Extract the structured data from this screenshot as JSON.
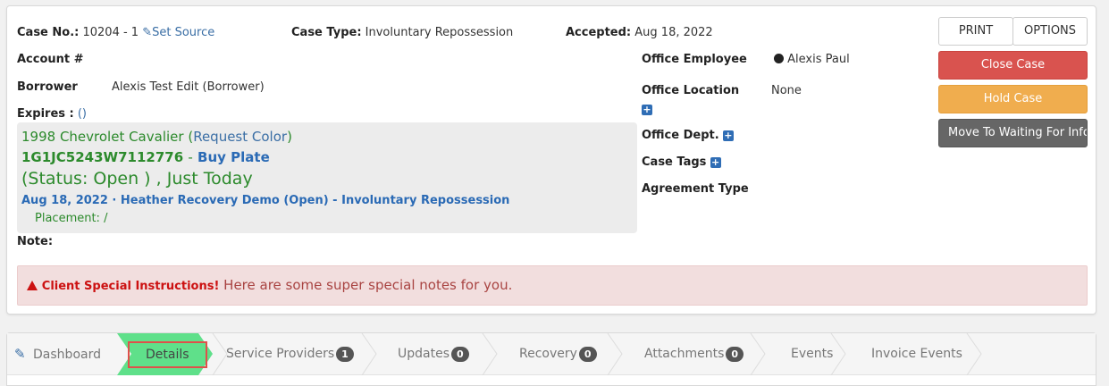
{
  "case": {
    "case_no_label": "Case No.:",
    "case_no_value": "10204 - 1",
    "set_source": "Set Source",
    "case_type_label": "Case Type:",
    "case_type_value": "Involuntary Repossession",
    "accepted_label": "Accepted:",
    "accepted_value": "Aug 18, 2022",
    "account_label": "Account #",
    "borrower_label": "Borrower",
    "borrower_value": "Alexis Test Edit (Borrower)",
    "expires_label": "Expires :",
    "expires_value": "()",
    "note_label": "Note:"
  },
  "vehicle": {
    "name": "1998 Chevrolet Cavalier",
    "request_color_open": "(",
    "request_color": "Request Color",
    "request_color_close": ")",
    "vin": "1G1JC5243W7112776",
    "dash": "-",
    "buy_plate": "Buy Plate",
    "status": "(Status: Open ) , Just Today",
    "assignment": "Aug 18, 2022 · Heather Recovery Demo (Open) - Involuntary Repossession",
    "placement": "Placement: /"
  },
  "office": {
    "employee_label": "Office Employee",
    "employee_value": "Alexis Paul",
    "location_label": "Office Location",
    "location_value": "None",
    "dept_label": "Office Dept.",
    "tags_label": "Case Tags",
    "agreement_label": "Agreement Type"
  },
  "actions": {
    "print": "PRINT",
    "options": "OPTIONS",
    "close_case": "Close Case",
    "hold_case": "Hold Case",
    "move_waiting": "Move To Waiting For Info"
  },
  "alert": {
    "title": "Client Special Instructions!",
    "message": "Here are some super special notes for you."
  },
  "tabs": [
    {
      "label": "Dashboard"
    },
    {
      "label": "Details",
      "active": true
    },
    {
      "label": "Service Providers",
      "badge": "1"
    },
    {
      "label": "Updates",
      "badge": "0"
    },
    {
      "label": "Recovery",
      "badge": "0"
    },
    {
      "label": "Attachments",
      "badge": "0"
    },
    {
      "label": "Events"
    },
    {
      "label": "Invoice Events"
    }
  ],
  "colors": {
    "green": "#2c8a2c",
    "blue_link": "#3a6ea5",
    "active_tab": "#5fe08a",
    "danger": "#d9534f",
    "warning": "#f0ad4e"
  }
}
